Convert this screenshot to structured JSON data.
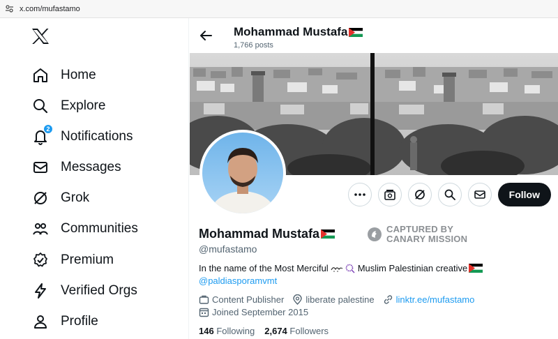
{
  "browser": {
    "url": "x.com/mufastamo"
  },
  "sidebar": {
    "items": [
      {
        "label": "Home",
        "icon": "home-icon"
      },
      {
        "label": "Explore",
        "icon": "search-icon"
      },
      {
        "label": "Notifications",
        "icon": "bell-icon",
        "badge": "2"
      },
      {
        "label": "Messages",
        "icon": "mail-icon"
      },
      {
        "label": "Grok",
        "icon": "grok-icon"
      },
      {
        "label": "Communities",
        "icon": "people-icon"
      },
      {
        "label": "Premium",
        "icon": "verified-icon"
      },
      {
        "label": "Verified Orgs",
        "icon": "lightning-icon"
      },
      {
        "label": "Profile",
        "icon": "person-icon"
      }
    ]
  },
  "header": {
    "name": "Mohammad Mustafa",
    "posts": "1,766 posts"
  },
  "profile": {
    "name": "Mohammad Mustafa",
    "handle": "@mufastamo",
    "bio": "In the name of the Most Merciful ❤️ Muslim Palestinian creative",
    "bio_main": "In the name of the Most Merciful",
    "bio_tail": "Muslim Palestinian creative",
    "bio_mention": "@paldiasporamvmt",
    "category": "Content Publisher",
    "location": "liberate palestine",
    "website": "linktr.ee/mufastamo",
    "joined": "Joined September 2015",
    "following_count": "146",
    "following_label": "Following",
    "followers_count": "2,674",
    "followers_label": "Followers"
  },
  "canary": {
    "line1": "CAPTURED BY",
    "line2": "CANARY MISSION"
  },
  "actions": {
    "follow_label": "Follow"
  },
  "colors": {
    "accent": "#1d9bf0",
    "text": "#0f1419",
    "muted": "#536471"
  }
}
